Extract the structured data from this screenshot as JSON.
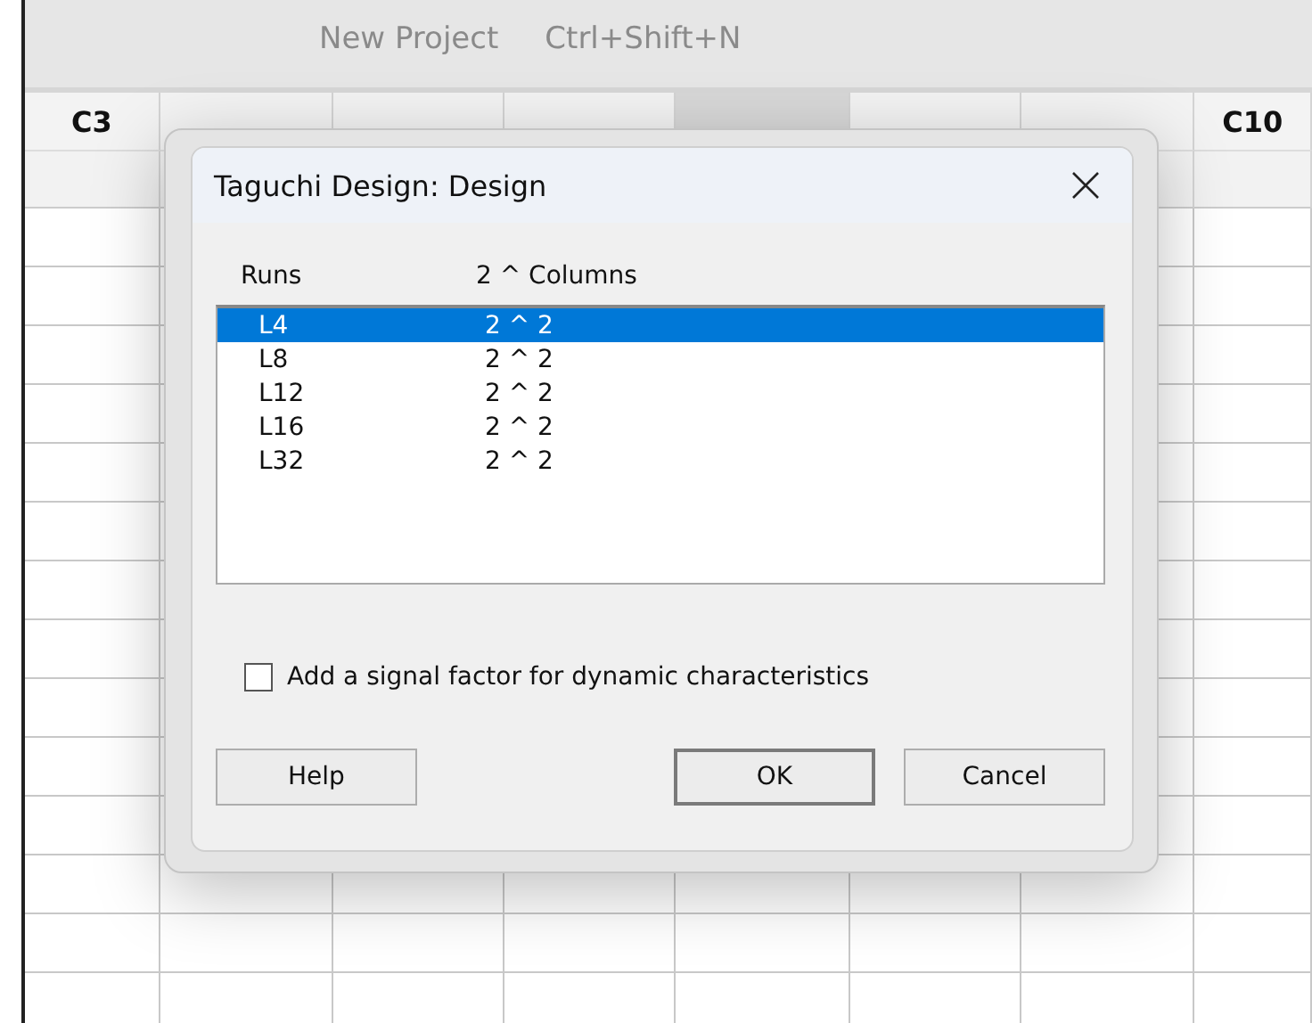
{
  "menu_item": {
    "label": "New Project",
    "shortcut": "Ctrl+Shift+N",
    "disabled": true
  },
  "worksheet": {
    "columns": [
      {
        "label": "C3",
        "selected": false
      },
      {
        "selected": false
      },
      {
        "selected": false
      },
      {
        "selected": false
      },
      {
        "selected": true
      },
      {
        "selected": false
      },
      {
        "selected": false
      },
      {
        "label": "C10",
        "selected": false
      }
    ]
  },
  "dialog": {
    "title": "Taguchi Design: Design",
    "list_headers": [
      "Runs",
      "2 ^ Columns"
    ],
    "designs": [
      {
        "runs": "L4",
        "columns": "2 ^  2",
        "selected": true
      },
      {
        "runs": "L8",
        "columns": "2 ^  2",
        "selected": false
      },
      {
        "runs": "L12",
        "columns": "2 ^  2",
        "selected": false
      },
      {
        "runs": "L16",
        "columns": "2 ^  2",
        "selected": false
      },
      {
        "runs": "L32",
        "columns": "2 ^  2",
        "selected": false
      }
    ],
    "signal_factor": {
      "label": "Add a signal factor for dynamic characteristics",
      "checked": false
    },
    "buttons": [
      {
        "label": "Help",
        "kind": "help"
      },
      {
        "label": "OK",
        "kind": "default"
      },
      {
        "label": "Cancel",
        "kind": "normal"
      }
    ]
  }
}
